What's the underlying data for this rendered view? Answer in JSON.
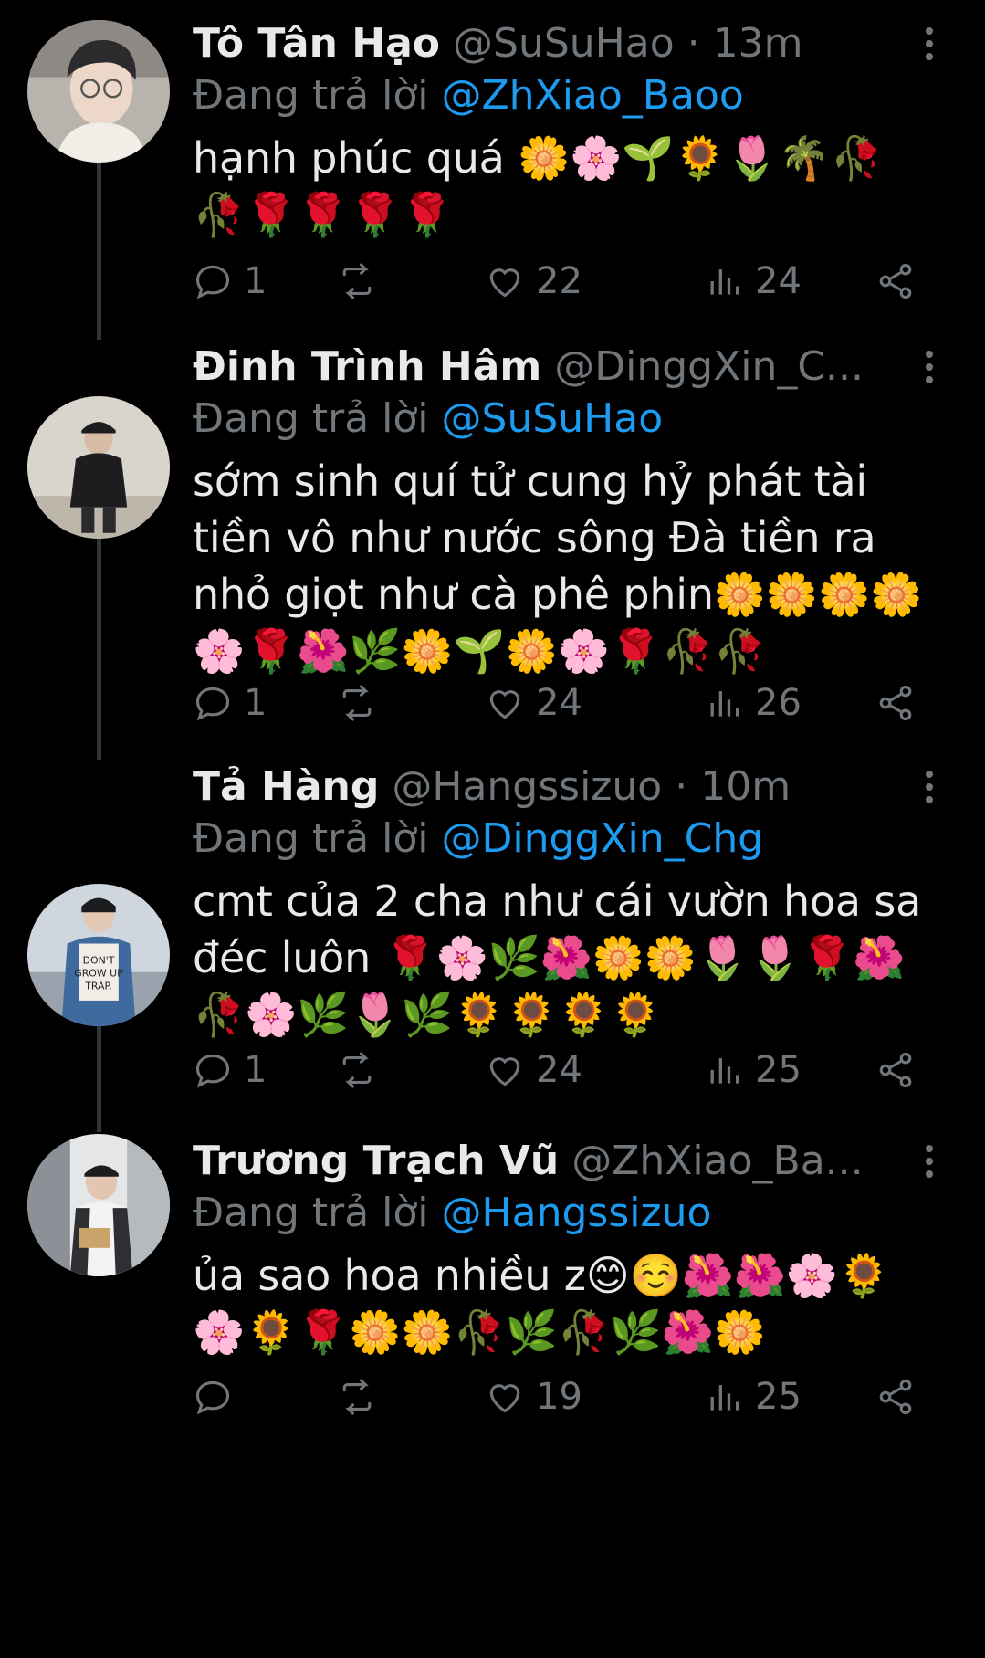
{
  "replying_prefix": "Đang trả lời",
  "tweets": [
    {
      "name": "Tô Tân Hạo",
      "handle": "@SuSuHao",
      "time": "13m",
      "reply_to": "@ZhXiao_Baoo",
      "text": "hạnh phúc quá 🌼🌸🌱🌻🌷🌴🥀🥀🌹🌹🌹🌹",
      "replies": "1",
      "retweets": "",
      "likes": "22",
      "views": "24"
    },
    {
      "name": "Đinh Trình Hâm",
      "handle": "@DinggXin_C...",
      "time": "",
      "reply_to": "@SuSuHao",
      "text": "sớm sinh quí tử cung hỷ phát tài tiền vô như nước sông Đà tiền ra nhỏ giọt như cà phê phin🌼🌼🌼🌼🌸🌹🌺🌿🌼🌱🌼🌸🌹🥀🥀",
      "replies": "1",
      "retweets": "",
      "likes": "24",
      "views": "26"
    },
    {
      "name": "Tả Hàng",
      "handle": "@Hangssizuo",
      "time": "10m",
      "reply_to": "@DinggXin_Chg",
      "text": "cmt của 2 cha như cái vườn hoa sa đéc luôn 🌹🌸🌿🌺🌼🌼🌷🌷🌹🌺🥀🌸🌿🌷🌿🌻🌻🌻🌻",
      "replies": "1",
      "retweets": "",
      "likes": "24",
      "views": "25"
    },
    {
      "name": "Trương Trạch Vũ",
      "handle": "@ZhXiao_Ba...",
      "time": "",
      "reply_to": "@Hangssizuo",
      "text": "ủa sao hoa nhiều z😊☺️🌺🌺🌸🌻🌸🌻🌹🌼🌼🥀🌿🥀🌿🌺🌼",
      "replies": "",
      "retweets": "",
      "likes": "19",
      "views": "25"
    }
  ],
  "colors": {
    "background": "#000000",
    "text": "#e7e9ea",
    "muted": "#71767b",
    "link": "#1d9bf0"
  }
}
